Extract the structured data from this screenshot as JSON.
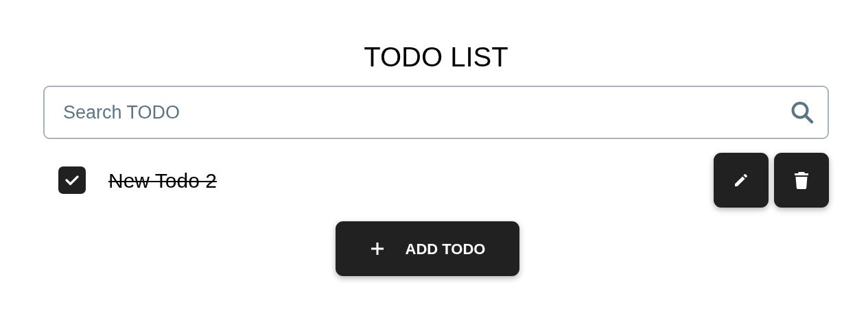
{
  "title": "TODO LIST",
  "search": {
    "placeholder": "Search TODO"
  },
  "todos": [
    {
      "text": "New Todo 2",
      "checked": true
    }
  ],
  "add_button": {
    "label": "ADD TODO"
  }
}
